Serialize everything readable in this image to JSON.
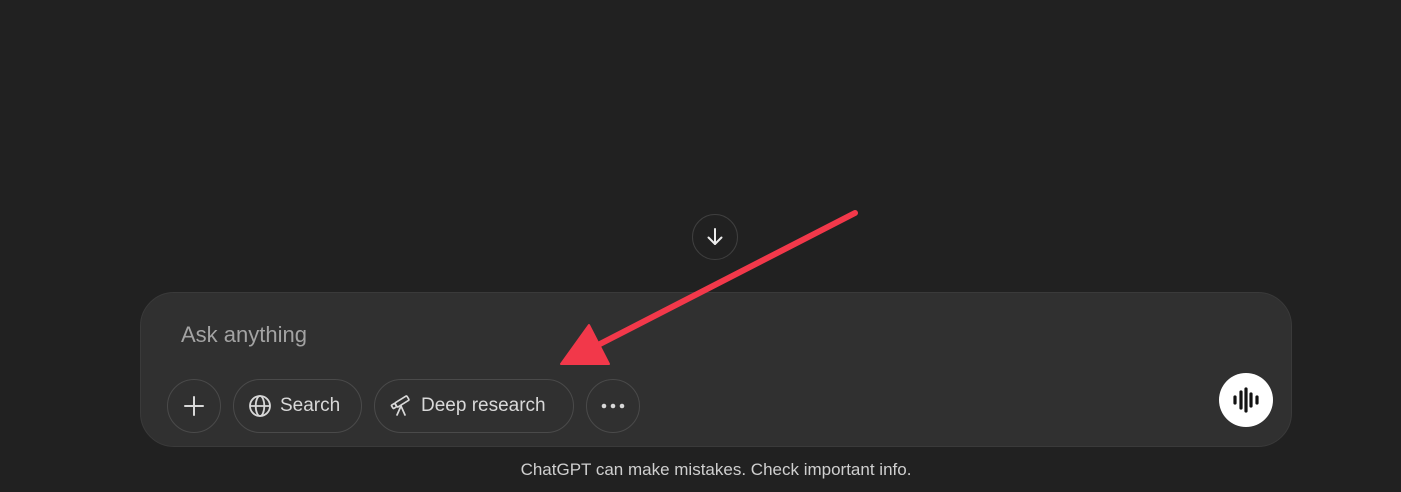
{
  "composer": {
    "placeholder": "Ask anything",
    "tools": {
      "add_icon": "plus-icon",
      "search_label": "Search",
      "search_icon": "globe-icon",
      "deep_research_label": "Deep research",
      "deep_research_icon": "telescope-icon",
      "more_icon": "ellipsis-icon"
    },
    "voice_icon": "voice-waveform-icon"
  },
  "scroll_down_icon": "arrow-down-icon",
  "footer": {
    "disclaimer": "ChatGPT can make mistakes. Check important info."
  },
  "annotation": {
    "arrow_color": "#f2384a",
    "points_to": "Deep research"
  },
  "colors": {
    "background": "#212121",
    "composer": "#303030",
    "text": "#ececec",
    "muted_text": "#a3a3a3"
  }
}
